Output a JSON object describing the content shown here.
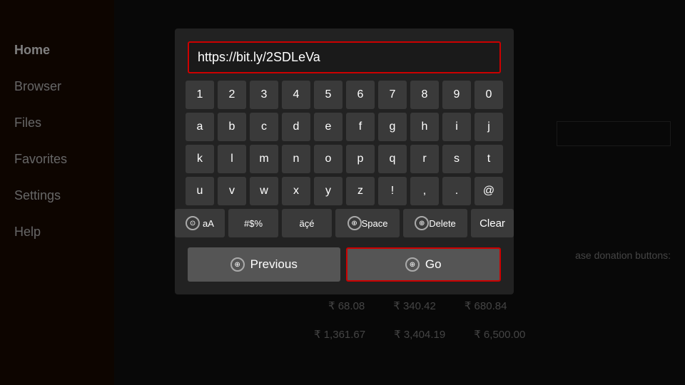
{
  "sidebar": {
    "items": [
      {
        "label": "Home",
        "active": true
      },
      {
        "label": "Browser",
        "active": false
      },
      {
        "label": "Files",
        "active": false
      },
      {
        "label": "Favorites",
        "active": false
      },
      {
        "label": "Settings",
        "active": false
      },
      {
        "label": "Help",
        "active": false
      }
    ]
  },
  "dialog": {
    "url_value": "https://bit.ly/2SDLeVa",
    "keyboard": {
      "row1": [
        "1",
        "2",
        "3",
        "4",
        "5",
        "6",
        "7",
        "8",
        "9",
        "0"
      ],
      "row2": [
        "a",
        "b",
        "c",
        "d",
        "e",
        "f",
        "g",
        "h",
        "i",
        "j"
      ],
      "row3": [
        "k",
        "l",
        "m",
        "n",
        "o",
        "p",
        "q",
        "r",
        "s",
        "t"
      ],
      "row4": [
        "u",
        "v",
        "w",
        "x",
        "y",
        "z",
        "!",
        ",",
        ".",
        "@"
      ],
      "row5": [
        {
          "label": "aA",
          "type": "wide"
        },
        {
          "label": "#$%",
          "type": "wide"
        },
        {
          "label": "äçé",
          "type": "wide"
        },
        {
          "label": "Space",
          "type": "wider"
        },
        {
          "label": "Delete",
          "type": "wider"
        },
        {
          "label": "Clear",
          "type": "clear"
        }
      ]
    },
    "previous_label": "Previous",
    "go_label": "Go"
  },
  "background": {
    "donation_text": "ase donation buttons:",
    "paren_text": ")",
    "prices": {
      "row1": [
        "₹ 68.08",
        "₹ 340.42",
        "₹ 680.84"
      ],
      "row2": [
        "₹ 1,361.67",
        "₹ 3,404.19",
        "₹ 6,500.00"
      ]
    }
  }
}
